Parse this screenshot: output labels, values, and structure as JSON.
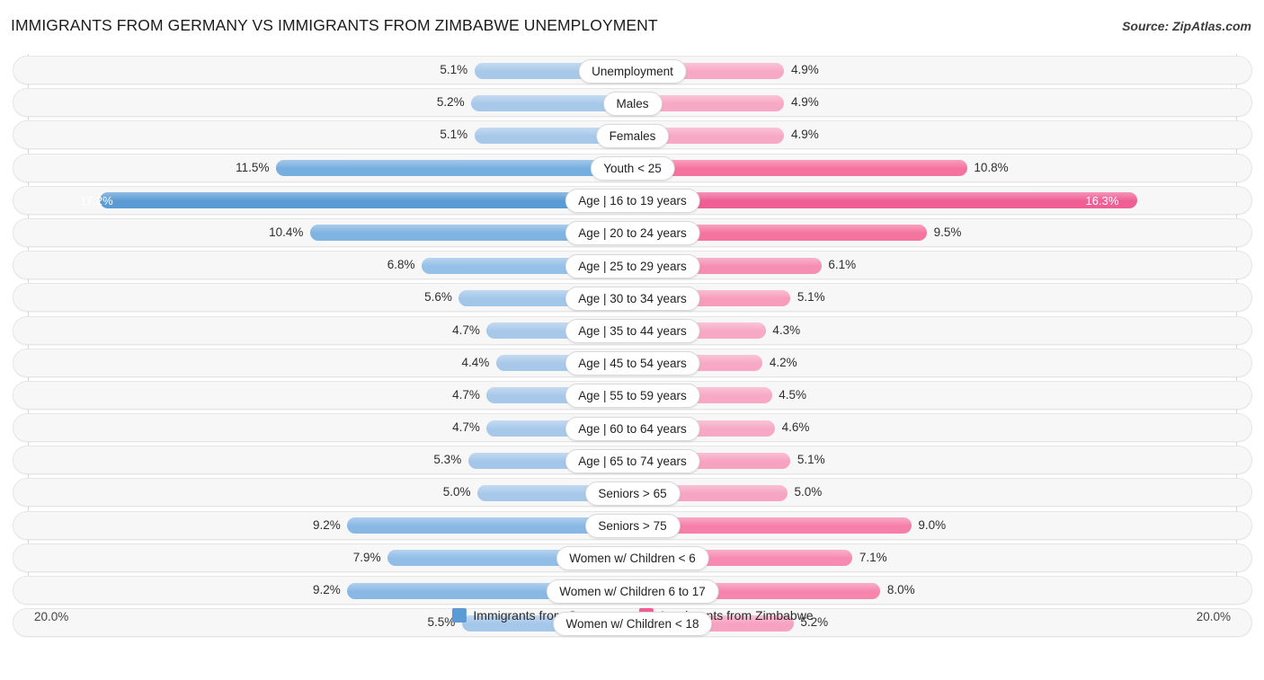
{
  "header": {
    "title": "IMMIGRANTS FROM GERMANY VS IMMIGRANTS FROM ZIMBABWE UNEMPLOYMENT",
    "source": "Source: ZipAtlas.com"
  },
  "axis": {
    "min_label": "20.0%",
    "max_label": "20.0%"
  },
  "legend": {
    "items": [
      {
        "label": "Immigrants from Germany",
        "color": "#5b9bd5"
      },
      {
        "label": "Immigrants from Zimbabwe",
        "color": "#ef5f94"
      }
    ]
  },
  "colors": {
    "blue_light": "#a8c8ea",
    "blue_mid": "#8cb8e4",
    "blue_strong": "#5b9bd5",
    "pink_light": "#f7a8c4",
    "pink_mid": "#f58cb0",
    "pink_strong": "#ef5f94",
    "track": "#f7f7f7",
    "track_border": "#e6e6e6"
  },
  "chart_data": {
    "type": "bar",
    "orientation": "horizontal-diverging",
    "title": "IMMIGRANTS FROM GERMANY VS IMMIGRANTS FROM ZIMBABWE UNEMPLOYMENT",
    "xlabel": "",
    "ylabel": "",
    "xlim": [
      20.0,
      20.0
    ],
    "axis_max_percent": 20.0,
    "grid": false,
    "legend_position": "bottom-center",
    "categories": [
      "Unemployment",
      "Males",
      "Females",
      "Youth < 25",
      "Age | 16 to 19 years",
      "Age | 20 to 24 years",
      "Age | 25 to 29 years",
      "Age | 30 to 34 years",
      "Age | 35 to 44 years",
      "Age | 45 to 54 years",
      "Age | 55 to 59 years",
      "Age | 60 to 64 years",
      "Age | 65 to 74 years",
      "Seniors > 65",
      "Seniors > 75",
      "Women w/ Children < 6",
      "Women w/ Children 6 to 17",
      "Women w/ Children < 18"
    ],
    "series": [
      {
        "name": "Immigrants from Germany",
        "side": "left",
        "values": [
          5.1,
          5.2,
          5.1,
          11.5,
          17.2,
          10.4,
          6.8,
          5.6,
          4.7,
          4.4,
          4.7,
          4.7,
          5.3,
          5.0,
          9.2,
          7.9,
          9.2,
          5.5
        ]
      },
      {
        "name": "Immigrants from Zimbabwe",
        "side": "right",
        "values": [
          4.9,
          4.9,
          4.9,
          10.8,
          16.3,
          9.5,
          6.1,
          5.1,
          4.3,
          4.2,
          4.5,
          4.6,
          5.1,
          5.0,
          9.0,
          7.1,
          8.0,
          5.2
        ]
      }
    ]
  },
  "rows": [
    {
      "label": "Unemployment",
      "left_value": "5.1%",
      "right_value": "4.9%",
      "left_num": 5.1,
      "right_num": 4.9,
      "left_color": "#a8c8ea",
      "right_color": "#f7a8c4",
      "left_inside": false,
      "right_inside": false
    },
    {
      "label": "Males",
      "left_value": "5.2%",
      "right_value": "4.9%",
      "left_num": 5.2,
      "right_num": 4.9,
      "left_color": "#a8c8ea",
      "right_color": "#f7a8c4",
      "left_inside": false,
      "right_inside": false
    },
    {
      "label": "Females",
      "left_value": "5.1%",
      "right_value": "4.9%",
      "left_num": 5.1,
      "right_num": 4.9,
      "left_color": "#a8c8ea",
      "right_color": "#f7a8c4",
      "left_inside": false,
      "right_inside": false
    },
    {
      "label": "Youth < 25",
      "left_value": "11.5%",
      "right_value": "10.8%",
      "left_num": 11.5,
      "right_num": 10.8,
      "left_color": "#76aee0",
      "right_color": "#f5729f",
      "left_inside": false,
      "right_inside": false
    },
    {
      "label": "Age | 16 to 19 years",
      "left_value": "17.2%",
      "right_value": "16.3%",
      "left_num": 17.2,
      "right_num": 16.3,
      "left_color": "#5b9bd5",
      "right_color": "#ef5f94",
      "left_inside": true,
      "right_inside": true
    },
    {
      "label": "Age | 20 to 24 years",
      "left_value": "10.4%",
      "right_value": "9.5%",
      "left_num": 10.4,
      "right_num": 9.5,
      "left_color": "#7fb3e2",
      "right_color": "#f5749f",
      "left_inside": false,
      "right_inside": false
    },
    {
      "label": "Age | 25 to 29 years",
      "left_value": "6.8%",
      "right_value": "6.1%",
      "left_num": 6.8,
      "right_num": 6.1,
      "left_color": "#95c0e8",
      "right_color": "#f68db2",
      "left_inside": false,
      "right_inside": false
    },
    {
      "label": "Age | 30 to 34 years",
      "left_value": "5.6%",
      "right_value": "5.1%",
      "left_num": 5.6,
      "right_num": 5.1,
      "left_color": "#a1c6e9",
      "right_color": "#f79dbb",
      "left_inside": false,
      "right_inside": false
    },
    {
      "label": "Age | 35 to 44 years",
      "left_value": "4.7%",
      "right_value": "4.3%",
      "left_num": 4.7,
      "right_num": 4.3,
      "left_color": "#a8c8ea",
      "right_color": "#f7a8c4",
      "left_inside": false,
      "right_inside": false
    },
    {
      "label": "Age | 45 to 54 years",
      "left_value": "4.4%",
      "right_value": "4.2%",
      "left_num": 4.4,
      "right_num": 4.2,
      "left_color": "#a8c8ea",
      "right_color": "#f7a8c4",
      "left_inside": false,
      "right_inside": false
    },
    {
      "label": "Age | 55 to 59 years",
      "left_value": "4.7%",
      "right_value": "4.5%",
      "left_num": 4.7,
      "right_num": 4.5,
      "left_color": "#a8c8ea",
      "right_color": "#f7a8c4",
      "left_inside": false,
      "right_inside": false
    },
    {
      "label": "Age | 60 to 64 years",
      "left_value": "4.7%",
      "right_value": "4.6%",
      "left_num": 4.7,
      "right_num": 4.6,
      "left_color": "#a8c8ea",
      "right_color": "#f7a8c4",
      "left_inside": false,
      "right_inside": false
    },
    {
      "label": "Age | 65 to 74 years",
      "left_value": "5.3%",
      "right_value": "5.1%",
      "left_num": 5.3,
      "right_num": 5.1,
      "left_color": "#a4c7e9",
      "right_color": "#f7a2c0",
      "left_inside": false,
      "right_inside": false
    },
    {
      "label": "Seniors > 65",
      "left_value": "5.0%",
      "right_value": "5.0%",
      "left_num": 5.0,
      "right_num": 5.0,
      "left_color": "#a8c8ea",
      "right_color": "#f7a4c2",
      "left_inside": false,
      "right_inside": false
    },
    {
      "label": "Seniors > 75",
      "left_value": "9.2%",
      "right_value": "9.0%",
      "left_num": 9.2,
      "right_num": 9.0,
      "left_color": "#89b8e5",
      "right_color": "#f67fa9",
      "left_inside": false,
      "right_inside": false
    },
    {
      "label": "Women w/ Children < 6",
      "left_value": "7.9%",
      "right_value": "7.1%",
      "left_num": 7.9,
      "right_num": 7.1,
      "left_color": "#91bde7",
      "right_color": "#f68ab0",
      "left_inside": false,
      "right_inside": false
    },
    {
      "label": "Women w/ Children 6 to 17",
      "left_value": "9.2%",
      "right_value": "8.0%",
      "left_num": 9.2,
      "right_num": 8.0,
      "left_color": "#89b8e5",
      "right_color": "#f685ad",
      "left_inside": false,
      "right_inside": false
    },
    {
      "label": "Women w/ Children < 18",
      "left_value": "5.5%",
      "right_value": "5.2%",
      "left_num": 5.5,
      "right_num": 5.2,
      "left_color": "#a5c7e9",
      "right_color": "#f7a2c0",
      "left_inside": false,
      "right_inside": false
    }
  ]
}
